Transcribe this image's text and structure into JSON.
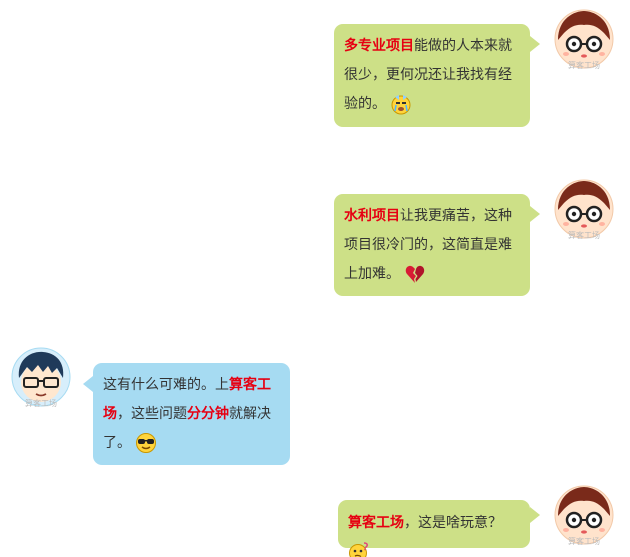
{
  "messages": [
    {
      "side": "right",
      "highlight": "多专业项目",
      "line1_rest": "能做的人本来就",
      "line2": "很少，更何况还让我找有经",
      "line3": "验的。",
      "emoji": "crying-emoji"
    },
    {
      "side": "right",
      "highlight": "水利项目",
      "line1_rest": "让我更痛苦，这种",
      "line2": "项目很冷门的，这简直是难",
      "line3": "上加难。",
      "emoji": "broken-heart-emoji"
    },
    {
      "side": "left",
      "line1_pre": "这有什么可难的。上",
      "line1_hl": "算客工",
      "line2_hl": "场",
      "line2_mid": "，这些问题",
      "line2_hl2": "分分钟",
      "line2_rest": "就解决",
      "line3": "了。",
      "emoji": "cool-sunglasses-emoji"
    },
    {
      "side": "right",
      "highlight": "算客工场",
      "line1_rest": "，这是啥玩意？",
      "emoji": "confused-emoji"
    }
  ],
  "avatars": {
    "girl": "girl-avatar",
    "boy": "boy-avatar"
  },
  "watermark": "算客工场",
  "colors": {
    "green_bubble": "#cde087",
    "blue_bubble": "#a6dbf2",
    "highlight": "#e60012",
    "text": "#333333"
  }
}
